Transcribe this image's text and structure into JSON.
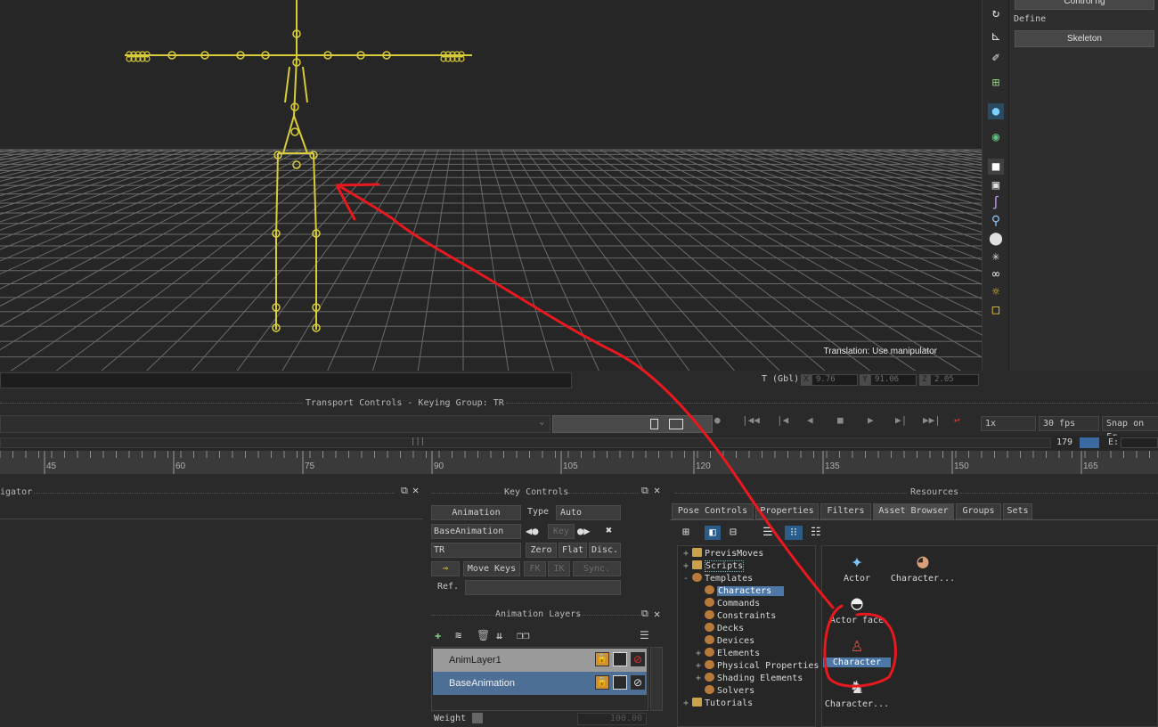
{
  "viewport": {
    "hint": "Translation: Use manipulator",
    "coords": {
      "label": "T (Gbl)",
      "x_tag": "X",
      "x": "9.76",
      "y_tag": "Y",
      "y": "91.06",
      "z_tag": "Z",
      "z": "2.05"
    }
  },
  "right_panel": {
    "top_button": "Control rig",
    "define_label": "Define",
    "skeleton_button": "Skeleton"
  },
  "transport": {
    "title": "Transport Controls  -  Keying Group: TR",
    "speed": "1x",
    "fps": "30 fps",
    "snap": "Snap on Fr",
    "frame": "179",
    "end_label": "E:"
  },
  "ruler": {
    "ticks": [
      "45",
      "60",
      "75",
      "90",
      "105",
      "120",
      "135",
      "150",
      "165"
    ]
  },
  "navigator": {
    "title": "igator"
  },
  "key_controls": {
    "title": "Key Controls",
    "mode": "Animation",
    "type_label": "Type",
    "type_value": "Auto",
    "layer_select": "BaseAnimation",
    "key_button": "Key",
    "group_select": "TR",
    "zero": "Zero",
    "flat": "Flat",
    "disc": "Disc.",
    "move_keys": "Move Keys",
    "fk": "FK",
    "ik": "IK",
    "sync": "Sync.",
    "ref_label": "Ref."
  },
  "anim_layers": {
    "title": "Animation Layers",
    "layers": [
      {
        "name": "AnimLayer1"
      },
      {
        "name": "BaseAnimation"
      }
    ],
    "weight_label": "Weight",
    "weight_value": "100.00"
  },
  "resources": {
    "title": "Resources",
    "tabs": [
      "Pose Controls",
      "Properties",
      "Filters",
      "Asset Browser",
      "Groups",
      "Sets"
    ],
    "active_tab": "Asset Browser",
    "tree": [
      {
        "label": "PrevisMoves",
        "level": 0,
        "expand": "+"
      },
      {
        "label": "Scripts",
        "level": 0,
        "expand": "+"
      },
      {
        "label": "Templates",
        "level": 0,
        "expand": "-"
      },
      {
        "label": "Characters",
        "level": 1,
        "expand": ""
      },
      {
        "label": "Commands",
        "level": 1,
        "expand": ""
      },
      {
        "label": "Constraints",
        "level": 1,
        "expand": ""
      },
      {
        "label": "Decks",
        "level": 1,
        "expand": ""
      },
      {
        "label": "Devices",
        "level": 1,
        "expand": ""
      },
      {
        "label": "Elements",
        "level": 1,
        "expand": "+"
      },
      {
        "label": "Physical Properties",
        "level": 1,
        "expand": "+"
      },
      {
        "label": "Shading Elements",
        "level": 1,
        "expand": "+"
      },
      {
        "label": "Solvers",
        "level": 1,
        "expand": ""
      },
      {
        "label": "Tutorials",
        "level": 0,
        "expand": "+"
      }
    ],
    "assets": [
      {
        "label": "Actor",
        "icon": "actor-icon"
      },
      {
        "label": "Character...",
        "icon": "character-head-icon"
      },
      {
        "label": "Actor face",
        "icon": "mask-icon"
      },
      {
        "label": "Character",
        "icon": "character-icon"
      },
      {
        "label": "Character...",
        "icon": "character-extension-icon"
      }
    ]
  },
  "annotation_color": "#e8181e",
  "skeleton_color": "#d8cc3a"
}
